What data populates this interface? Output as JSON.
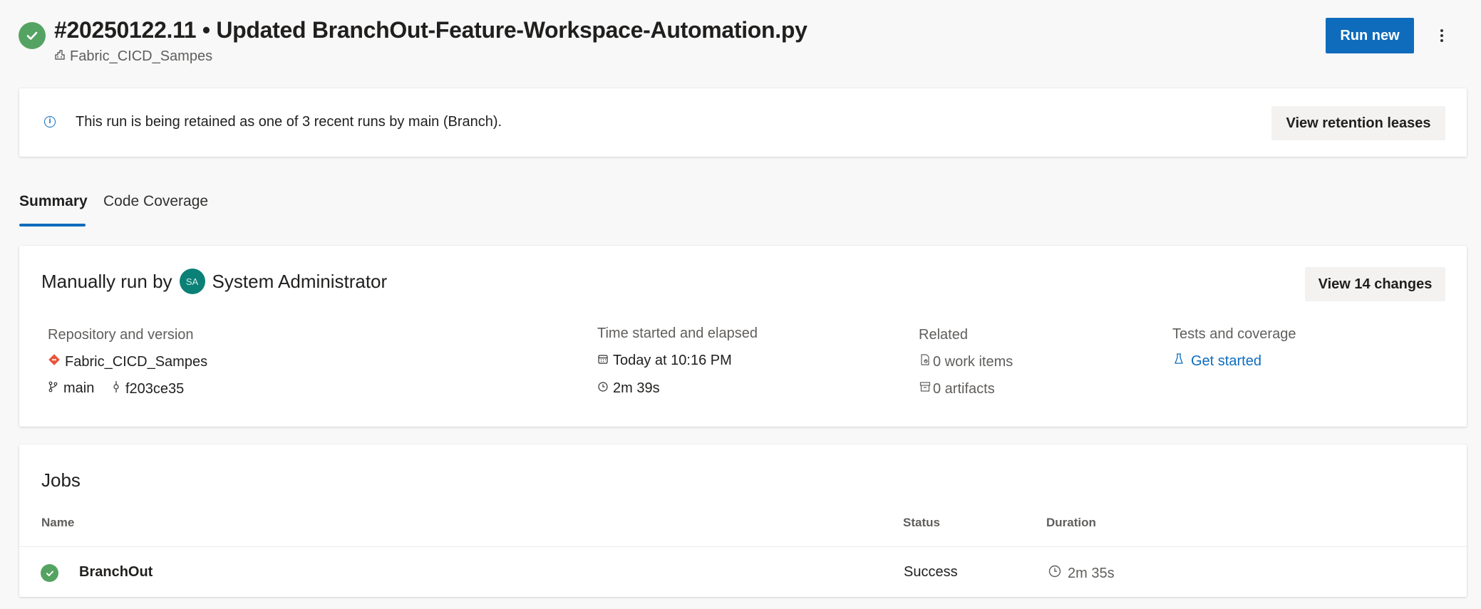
{
  "header": {
    "run_title": "#20250122.11 • Updated BranchOut-Feature-Workspace-Automation.py",
    "pipeline_name": "Fabric_CICD_Sampes",
    "run_new_label": "Run new",
    "status_color": "#55a362",
    "accent_color": "#0f6cbd"
  },
  "banner": {
    "message": "This run is being retained as one of 3 recent runs by main (Branch).",
    "button_label": "View retention leases"
  },
  "tabs": [
    {
      "label": "Summary",
      "selected": true
    },
    {
      "label": "Code Coverage",
      "selected": false
    }
  ],
  "summary": {
    "manually_run_by": "Manually run by",
    "avatar_initials": "SA",
    "user_name": "System Administrator",
    "changes_button": "View 14 changes",
    "repository": {
      "label": "Repository and version",
      "repo_name": "Fabric_CICD_Sampes",
      "branch": "main",
      "commit": "f203ce35"
    },
    "time": {
      "label": "Time started and elapsed",
      "started": "Today at 10:16 PM",
      "elapsed": "2m 39s"
    },
    "related": {
      "label": "Related",
      "work_items": "0 work items",
      "artifacts": "0 artifacts"
    },
    "tests": {
      "label": "Tests and coverage",
      "link": "Get started"
    }
  },
  "jobs": {
    "title": "Jobs",
    "columns": [
      "Name",
      "Status",
      "Duration"
    ],
    "rows": [
      {
        "name": "BranchOut",
        "status": "Success",
        "duration": "2m 35s"
      }
    ]
  }
}
